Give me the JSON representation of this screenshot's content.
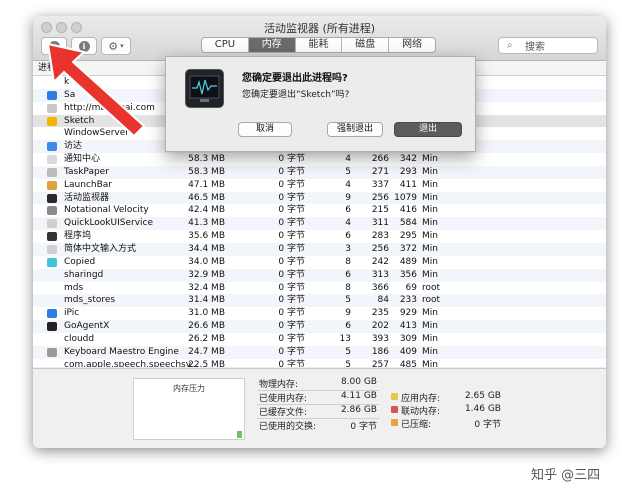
{
  "window": {
    "title": "活动监视器 (所有进程)"
  },
  "toolbar": {
    "tabs": [
      {
        "label": "CPU",
        "active": false
      },
      {
        "label": "内存",
        "active": true
      },
      {
        "label": "能耗",
        "active": false
      },
      {
        "label": "磁盘",
        "active": false
      },
      {
        "label": "网络",
        "active": false
      }
    ],
    "search_placeholder": "搜索"
  },
  "table": {
    "name_header": "进程名称",
    "rows": [
      {
        "name": "k",
        "mem": "",
        "compressed": "",
        "threads": "",
        "ports": "",
        "pid": "",
        "user": "",
        "icon_color": "",
        "selected": false
      },
      {
        "name": "Sa",
        "mem": "",
        "compressed": "",
        "threads": "",
        "ports": "",
        "pid": "",
        "user": "",
        "icon_color": "#2f7de1",
        "selected": false
      },
      {
        "name": "http://ma...spai.com",
        "mem": "",
        "compressed": "",
        "threads": "",
        "ports": "",
        "pid": "",
        "user": "",
        "icon_color": "#c8c8c8",
        "selected": false
      },
      {
        "name": "Sketch",
        "mem": "",
        "compressed": "",
        "threads": "",
        "ports": "",
        "pid": "",
        "user": "",
        "icon_color": "#f4b400",
        "selected": true
      },
      {
        "name": "WindowServer",
        "mem": "",
        "compressed": "",
        "threads": "",
        "ports": "",
        "pid": "",
        "user": "",
        "icon_color": "",
        "selected": false
      },
      {
        "name": "访达",
        "mem": "",
        "compressed": "",
        "threads": "",
        "ports": "",
        "pid": "",
        "user": "",
        "icon_color": "#3b8be8",
        "selected": false
      },
      {
        "name": "通知中心",
        "mem": "58.3 MB",
        "compressed": "0 字节",
        "threads": "4",
        "ports": "266",
        "pid": "342",
        "user": "Min",
        "icon_color": "#d9d9d9",
        "selected": false
      },
      {
        "name": "TaskPaper",
        "mem": "58.3 MB",
        "compressed": "0 字节",
        "threads": "5",
        "ports": "271",
        "pid": "293",
        "user": "Min",
        "icon_color": "#bbbbbb",
        "selected": false
      },
      {
        "name": "LaunchBar",
        "mem": "47.1 MB",
        "compressed": "0 字节",
        "threads": "4",
        "ports": "337",
        "pid": "411",
        "user": "Min",
        "icon_color": "#e0a23a",
        "selected": false
      },
      {
        "name": "活动监视器",
        "mem": "46.5 MB",
        "compressed": "0 字节",
        "threads": "9",
        "ports": "256",
        "pid": "1079",
        "user": "Min",
        "icon_color": "#2a2a2a",
        "selected": false
      },
      {
        "name": "Notational Velocity",
        "mem": "42.4 MB",
        "compressed": "0 字节",
        "threads": "6",
        "ports": "215",
        "pid": "416",
        "user": "Min",
        "icon_color": "#8a8a8a",
        "selected": false
      },
      {
        "name": "QuickLookUIService",
        "mem": "41.3 MB",
        "compressed": "0 字节",
        "threads": "4",
        "ports": "311",
        "pid": "584",
        "user": "Min",
        "icon_color": "#cfcfcf",
        "selected": false
      },
      {
        "name": "程序坞",
        "mem": "35.6 MB",
        "compressed": "0 字节",
        "threads": "6",
        "ports": "283",
        "pid": "295",
        "user": "Min",
        "icon_color": "#333333",
        "selected": false
      },
      {
        "name": "简体中文输入方式",
        "mem": "34.4 MB",
        "compressed": "0 字节",
        "threads": "3",
        "ports": "256",
        "pid": "372",
        "user": "Min",
        "icon_color": "#d0d0d0",
        "selected": false
      },
      {
        "name": "Copied",
        "mem": "34.0 MB",
        "compressed": "0 字节",
        "threads": "8",
        "ports": "242",
        "pid": "489",
        "user": "Min",
        "icon_color": "#3ec3d8",
        "selected": false
      },
      {
        "name": "sharingd",
        "mem": "32.9 MB",
        "compressed": "0 字节",
        "threads": "6",
        "ports": "313",
        "pid": "356",
        "user": "Min",
        "icon_color": "",
        "selected": false
      },
      {
        "name": "mds",
        "mem": "32.4 MB",
        "compressed": "0 字节",
        "threads": "8",
        "ports": "366",
        "pid": "69",
        "user": "root",
        "icon_color": "",
        "selected": false
      },
      {
        "name": "mds_stores",
        "mem": "31.4 MB",
        "compressed": "0 字节",
        "threads": "5",
        "ports": "84",
        "pid": "233",
        "user": "root",
        "icon_color": "",
        "selected": false
      },
      {
        "name": "iPic",
        "mem": "31.0 MB",
        "compressed": "0 字节",
        "threads": "9",
        "ports": "235",
        "pid": "929",
        "user": "Min",
        "icon_color": "#2f7de1",
        "selected": false
      },
      {
        "name": "GoAgentX",
        "mem": "26.6 MB",
        "compressed": "0 字节",
        "threads": "6",
        "ports": "202",
        "pid": "413",
        "user": "Min",
        "icon_color": "#222222",
        "selected": false
      },
      {
        "name": "cloudd",
        "mem": "26.2 MB",
        "compressed": "0 字节",
        "threads": "13",
        "ports": "393",
        "pid": "309",
        "user": "Min",
        "icon_color": "",
        "selected": false
      },
      {
        "name": "Keyboard Maestro Engine",
        "mem": "24.7 MB",
        "compressed": "0 字节",
        "threads": "5",
        "ports": "186",
        "pid": "409",
        "user": "Min",
        "icon_color": "#9a9a9a",
        "selected": false
      },
      {
        "name": "com.apple.speech.speechsy...",
        "mem": "22.5 MB",
        "compressed": "0 字节",
        "threads": "5",
        "ports": "257",
        "pid": "485",
        "user": "Min",
        "icon_color": "",
        "selected": false
      }
    ]
  },
  "footer": {
    "pressure_label": "内存压力",
    "pressure_fill": 0.12,
    "stats_left": [
      {
        "label": "物理内存:",
        "value": "8.00 GB"
      },
      {
        "label": "已使用内存:",
        "value": "4.11 GB"
      },
      {
        "label": "已缓存文件:",
        "value": "2.86 GB"
      },
      {
        "label": "已使用的交换:",
        "value": "0 字节"
      }
    ],
    "stats_right": [
      {
        "label": "应用内存:",
        "value": "2.65 GB",
        "color": "#e5c84a"
      },
      {
        "label": "联动内存:",
        "value": "1.46 GB",
        "color": "#d9534f"
      },
      {
        "label": "已压缩:",
        "value": "0 字节",
        "color": "#e8a33d"
      }
    ]
  },
  "dialog": {
    "title": "您确定要退出此进程吗?",
    "message": "您确定要退出“Sketch”吗?",
    "cancel_label": "取消",
    "force_quit_label": "强制退出",
    "quit_label": "退出"
  },
  "watermark": {
    "text": "知乎 @三四"
  },
  "colors": {
    "arrow": "#e8342c",
    "selected_row": "#e3e3e3",
    "active_tab": "#6b6b6b"
  }
}
